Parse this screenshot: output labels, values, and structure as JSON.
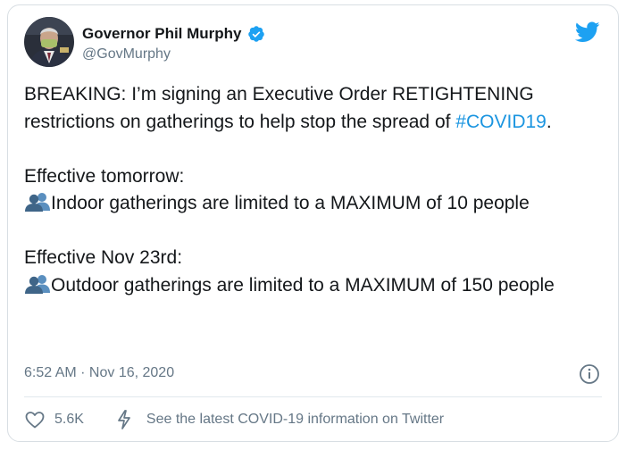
{
  "author": {
    "name": "Governor Phil Murphy",
    "handle": "@GovMurphy"
  },
  "icons": {
    "verified": "verified-badge-icon",
    "platform": "twitter-bird-icon",
    "people": "busts-in-silhouette-icon",
    "info": "info-icon",
    "like": "heart-icon",
    "covid_info": "lightning-bolt-icon"
  },
  "tweet": {
    "line1_a": "BREAKING: I’m signing an Executive Order RETIGHTENING restrictions on gatherings to help stop the spread of ",
    "hashtag": "#COVID19",
    "line1_b": ".",
    "section1_header": "Effective tomorrow:",
    "section1_text": "Indoor gatherings are limited to a MAXIMUM of 10 people",
    "section2_header": "Effective Nov 23rd:",
    "section2_text": "Outdoor gatherings are limited to a MAXIMUM of 150 people"
  },
  "meta": {
    "timestamp": "6:52 AM · Nov 16, 2020"
  },
  "actions": {
    "like_count": "5.6K",
    "covid_link": "See the latest COVID-19 information on Twitter"
  },
  "colors": {
    "accent": "#1b95e0",
    "muted": "#657786",
    "text": "#14171a",
    "border": "#d8dee3"
  }
}
